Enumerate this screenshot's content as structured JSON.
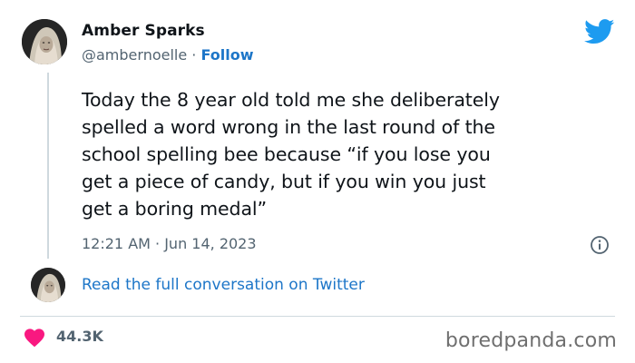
{
  "author": {
    "name": "Amber Sparks",
    "handle": "@ambernoelle",
    "separator": " · ",
    "follow_label": "Follow"
  },
  "tweet": {
    "text": "Today the 8 year old told me she deliberately\nspelled a word wrong in the last round of the\nschool spelling bee because “if you lose you\nget a piece of candy, but if you win you just\nget a boring medal”",
    "timestamp": "12:21 AM · Jun 14, 2023"
  },
  "conversation": {
    "link_label": "Read the full conversation on Twitter"
  },
  "engagement": {
    "likes": "44.3K"
  },
  "watermark": "boredpanda.com",
  "colors": {
    "link_blue": "#1d76c8",
    "twitter_blue": "#1d9bf0",
    "heart_pink": "#f91880",
    "muted_text": "#536471",
    "divider": "#cfd9de"
  },
  "icons": {
    "logo": "twitter-bird-icon",
    "info": "info-icon",
    "like": "heart-icon"
  }
}
